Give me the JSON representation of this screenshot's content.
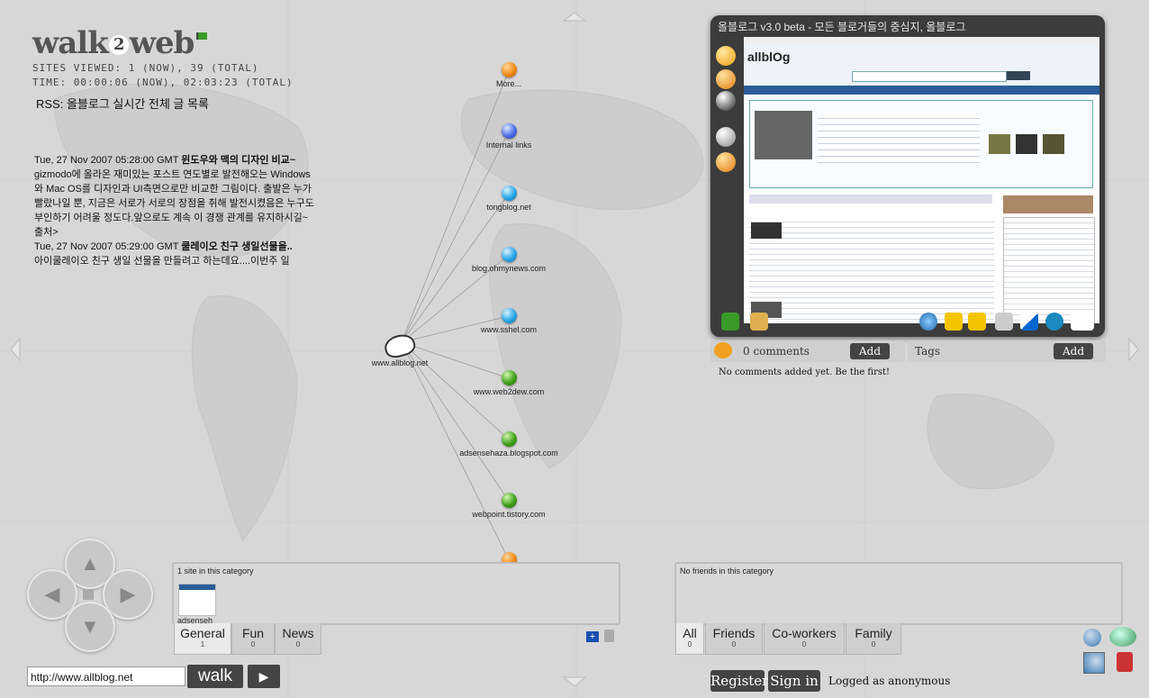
{
  "header": {
    "logo_walk": "walk",
    "logo_two": "2",
    "logo_web": "web",
    "sites_viewed": "SITES VIEWED: 1 (NOW), 39 (TOTAL)",
    "time": "TIME: 00:00:06 (NOW), 02:03:23 (TOTAL)",
    "rss": "RSS: 올블로그 실시간 전체 글 목록"
  },
  "feed": {
    "item1_date": "Tue, 27 Nov 2007 05:28:00 GMT ",
    "item1_title": "윈도우와 맥의 디자인 비교~",
    "item1_body": "gizmodo에 올라온 재미있는 포스트 연도별로 발전해오는 Windows와 Mac OS를 디자인과 UI측면으로만 비교한 그림이다. 출발은 누가 빨랐나일 뿐, 지금은 서로가 서로의 장점을 취해 발전시켰음은 누구도 부인하기 어려울 정도다.앞으로도 계속 이 경쟁 관계를 유지하시길~출처>",
    "item2_date": "Tue, 27 Nov 2007 05:29:00 GMT ",
    "item2_title": "쿨레이오 친구 생일선물을..",
    "item2_body": "아이쿨레이오 친구 생일 선물을 만들려고 하는데요....이번주 일"
  },
  "graph": {
    "center": "www.allblog.net",
    "nodes": [
      {
        "label": "More...",
        "color": "orange"
      },
      {
        "label": "Internal links",
        "color": "blue"
      },
      {
        "label": "tongblog.net",
        "color": "cyan"
      },
      {
        "label": "blog.ohmynews.com",
        "color": "cyan"
      },
      {
        "label": "www.sshel.com",
        "color": "cyan"
      },
      {
        "label": "www.web2dew.com",
        "color": "green"
      },
      {
        "label": "adsensehaza.blogspot.com",
        "color": "green"
      },
      {
        "label": "webpoint.tistory.com",
        "color": "green"
      },
      {
        "label": "",
        "color": "orange"
      }
    ]
  },
  "preview": {
    "title": "올블로그 v3.0 beta - 모든 블로거들의 중심지, 올블로그",
    "site_logo": "allblOg"
  },
  "comments": {
    "count": "0 comments",
    "add": "Add",
    "tags": "Tags",
    "tags_add": "Add",
    "empty": "No comments added yet. Be the first!"
  },
  "sites_panel": {
    "header": "1 site in this category",
    "thumb_label": "adsenseh",
    "tabs": [
      {
        "label": "General",
        "count": "1"
      },
      {
        "label": "Fun",
        "count": "0"
      },
      {
        "label": "News",
        "count": "0"
      }
    ]
  },
  "friends_panel": {
    "header": "No friends in this category",
    "tabs": [
      {
        "label": "All",
        "count": "0"
      },
      {
        "label": "Friends",
        "count": "0"
      },
      {
        "label": "Co-workers",
        "count": "0"
      },
      {
        "label": "Family",
        "count": "0"
      }
    ]
  },
  "footer": {
    "url_value": "http://www.allblog.net",
    "walk": "walk",
    "play": "▶",
    "register": "Register",
    "signin": "Sign in",
    "logged": "Logged as anonymous"
  }
}
